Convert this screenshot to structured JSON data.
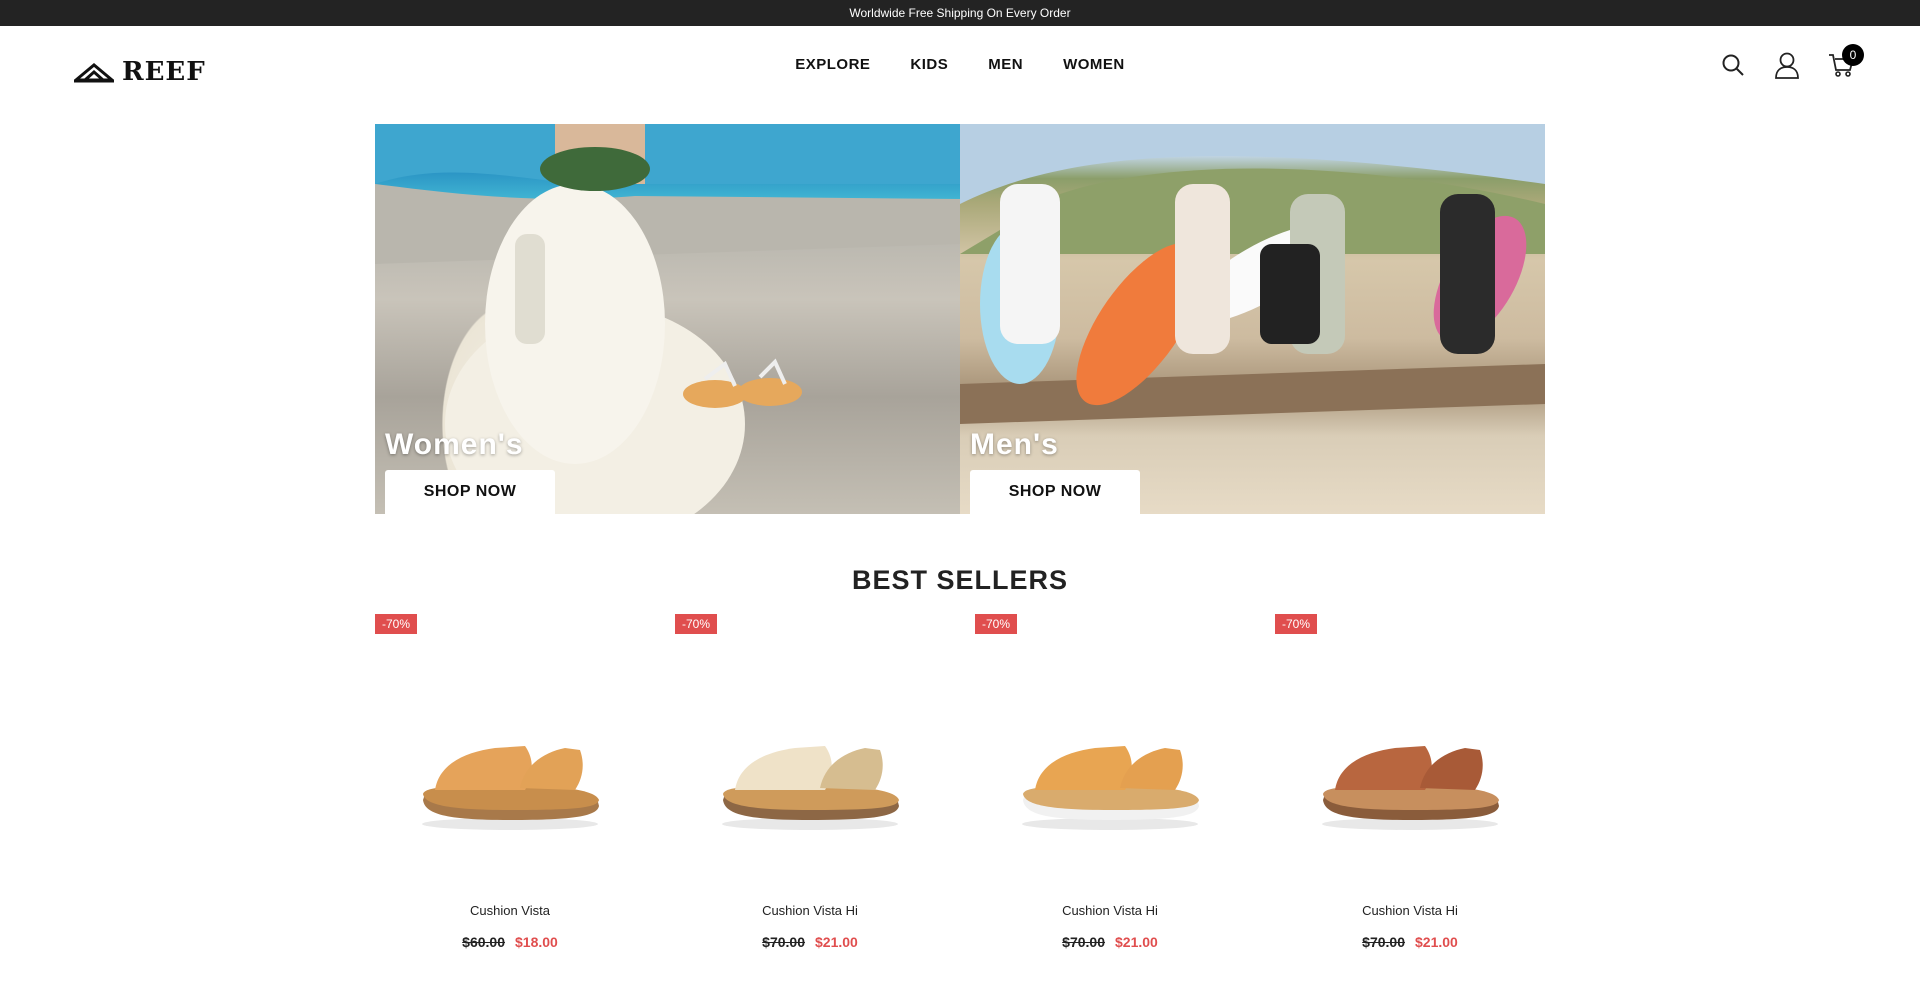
{
  "announcement": "Worldwide Free Shipping On Every Order",
  "brand": {
    "name": "REEF"
  },
  "nav": {
    "items": [
      "EXPLORE",
      "KIDS",
      "MEN",
      "WOMEN"
    ]
  },
  "header_icons": {
    "search": "search-icon",
    "account": "user-icon",
    "cart": "cart-icon",
    "cart_count": "0"
  },
  "banners": [
    {
      "title": "Women's",
      "cta": "SHOP NOW"
    },
    {
      "title": "Men's",
      "cta": "SHOP NOW"
    }
  ],
  "best_sellers": {
    "title": "BEST SELLERS",
    "products": [
      {
        "badge": "-70%",
        "name": "Cushion Vista",
        "old_price": "$60.00",
        "new_price": "$18.00",
        "colors": {
          "upper": "#e5a35a",
          "strap": "#e2a257",
          "sole": "#c88e4c",
          "tread": "#a8794a"
        }
      },
      {
        "badge": "-70%",
        "name": "Cushion Vista Hi",
        "old_price": "$70.00",
        "new_price": "$21.00",
        "colors": {
          "upper": "#efe2c8",
          "strap": "#d6bd90",
          "sole": "#cf9b5b",
          "tread": "#8d6745"
        }
      },
      {
        "badge": "-70%",
        "name": "Cushion Vista Hi",
        "old_price": "$70.00",
        "new_price": "$21.00",
        "colors": {
          "upper": "#e8a552",
          "strap": "#e4a050",
          "sole": "#d9ab6d",
          "tread": "#f1f1f1"
        }
      },
      {
        "badge": "-70%",
        "name": "Cushion Vista Hi",
        "old_price": "$70.00",
        "new_price": "$21.00",
        "colors": {
          "upper": "#b8663f",
          "strap": "#a85a37",
          "sole": "#c78f5e",
          "tread": "#8a5c3b"
        }
      }
    ]
  }
}
